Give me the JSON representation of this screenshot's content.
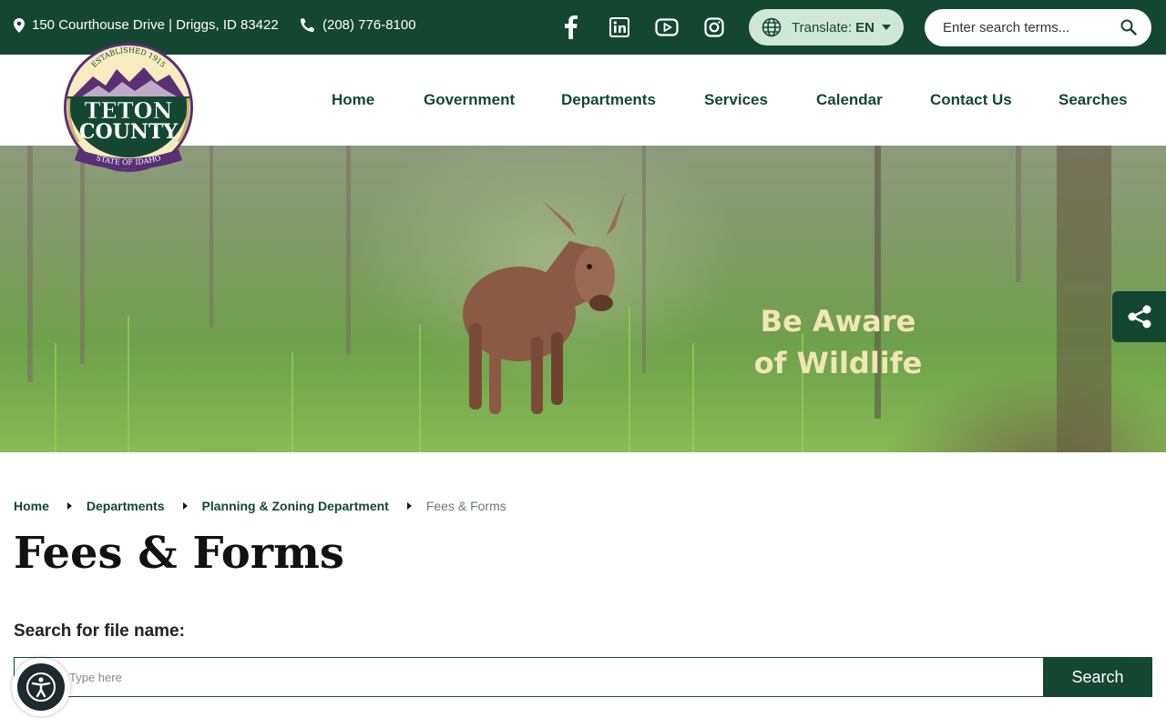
{
  "topbar": {
    "address": "150 Courthouse Drive | Driggs, ID 83422",
    "phone": "(208) 776-8100",
    "social": [
      "facebook-icon",
      "linkedin-icon",
      "youtube-icon",
      "instagram-icon"
    ],
    "translate_label": "Translate:",
    "translate_lang": "EN",
    "search_placeholder": "Enter search terms..."
  },
  "logo": {
    "established": "ESTABLISHED 1915",
    "line1": "TETON",
    "line2": "COUNTY",
    "ribbon": "STATE OF IDAHO"
  },
  "nav": {
    "items": [
      "Home",
      "Government",
      "Departments",
      "Services",
      "Calendar",
      "Contact Us",
      "Searches"
    ]
  },
  "hero": {
    "caption_line1": "Be Aware",
    "caption_line2": "of Wildlife"
  },
  "breadcrumb": {
    "items": [
      "Home",
      "Departments",
      "Planning & Zoning Department"
    ],
    "current": "Fees & Forms"
  },
  "page": {
    "title": "Fees & Forms",
    "search_label": "Search for file name:",
    "search_placeholder": "Type here",
    "search_button": "Search"
  },
  "colors": {
    "brand_green": "#144732",
    "translate_bg": "#cfe7d6",
    "caption": "#f1e6b5"
  }
}
